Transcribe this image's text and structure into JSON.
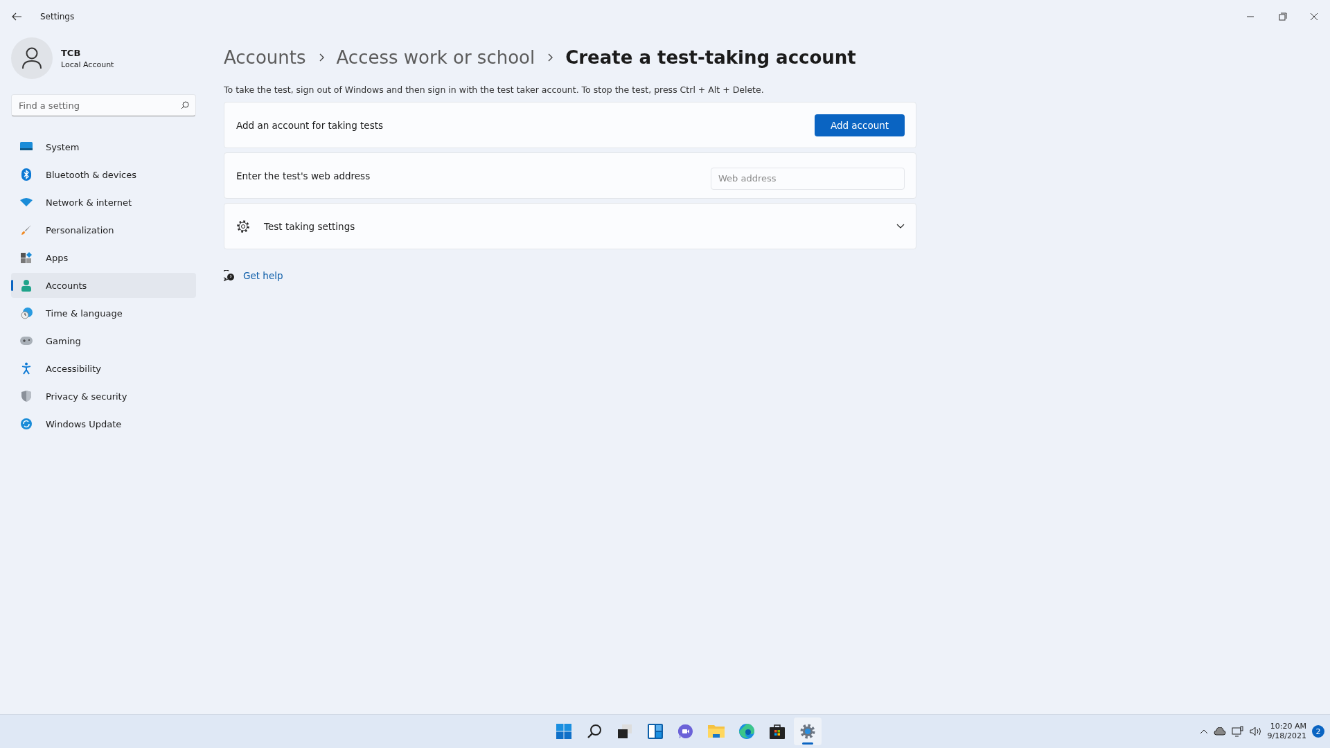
{
  "window": {
    "title": "Settings"
  },
  "profile": {
    "name": "TCB",
    "account_type": "Local Account"
  },
  "search": {
    "placeholder": "Find a setting"
  },
  "nav": [
    {
      "label": "System",
      "selected": false
    },
    {
      "label": "Bluetooth & devices",
      "selected": false
    },
    {
      "label": "Network & internet",
      "selected": false
    },
    {
      "label": "Personalization",
      "selected": false
    },
    {
      "label": "Apps",
      "selected": false
    },
    {
      "label": "Accounts",
      "selected": true
    },
    {
      "label": "Time & language",
      "selected": false
    },
    {
      "label": "Gaming",
      "selected": false
    },
    {
      "label": "Accessibility",
      "selected": false
    },
    {
      "label": "Privacy & security",
      "selected": false
    },
    {
      "label": "Windows Update",
      "selected": false
    }
  ],
  "breadcrumb": [
    "Accounts",
    "Access work or school",
    "Create a test-taking account"
  ],
  "description": "To take the test, sign out of Windows and then sign in with the test taker account. To stop the test, press Ctrl + Alt + Delete.",
  "cards": [
    {
      "kind": "button",
      "label": "Add an account for taking tests",
      "button": "Add account"
    },
    {
      "kind": "input",
      "label": "Enter the test's web address",
      "placeholder": "Web address"
    },
    {
      "kind": "expander",
      "label": "Test taking settings",
      "expanded": false
    }
  ],
  "help_link": "Get help",
  "taskbar": {
    "apps": [
      {
        "selected": false
      },
      {
        "selected": false
      },
      {
        "selected": false
      },
      {
        "selected": false
      },
      {
        "selected": false
      },
      {
        "selected": false
      },
      {
        "selected": false
      },
      {
        "selected": false
      },
      {
        "selected": true
      }
    ],
    "time": "10:20 AM",
    "date": "9/18/2021",
    "notifications": "2"
  }
}
